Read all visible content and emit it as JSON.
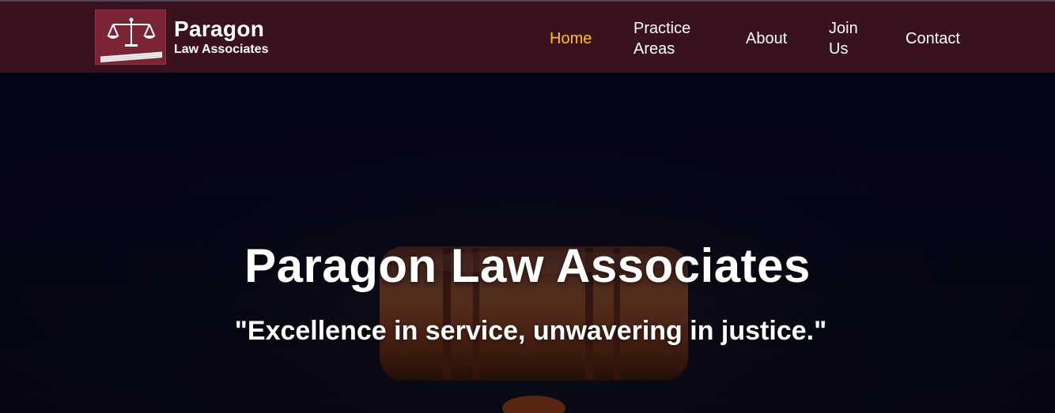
{
  "brand": {
    "name": "Paragon",
    "subtitle": "Law Associates",
    "logo_icon": "scales-of-justice-icon",
    "logo_color": "#7a2436"
  },
  "nav": {
    "items": [
      {
        "label": "Home",
        "active": true
      },
      {
        "label": "Practice Areas",
        "active": false
      },
      {
        "label": "About",
        "active": false
      },
      {
        "label": "Join Us",
        "active": false
      },
      {
        "label": "Contact",
        "active": false
      }
    ],
    "background": "#3a121d",
    "active_color": "#ffc21a"
  },
  "hero": {
    "title": "Paragon Law Associates",
    "tagline": "\"Excellence in service, unwavering in justice.\"",
    "background_image": "gavel-image"
  }
}
